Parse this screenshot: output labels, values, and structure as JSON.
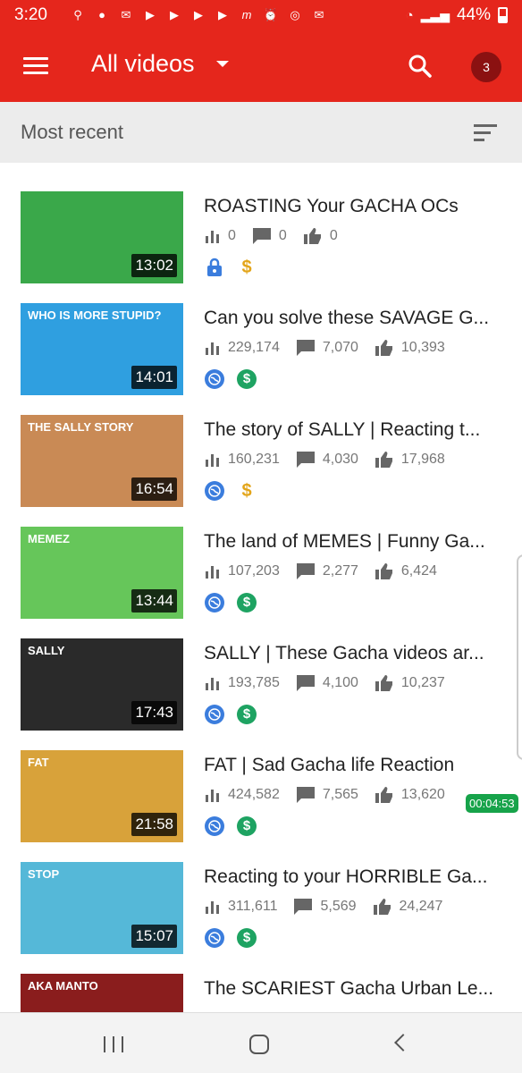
{
  "status_bar": {
    "time": "3:20",
    "battery": "44%",
    "notification_icons": [
      "location-icon",
      "reddit-icon",
      "gmail-icon",
      "youtube-icon",
      "youtube-icon",
      "youtube-icon",
      "youtube-icon",
      "m-icon",
      "alarm-icon",
      "instagram-icon",
      "gmail-icon"
    ]
  },
  "app_bar": {
    "title": "All videos",
    "notification_count": "3"
  },
  "sort_bar": {
    "label": "Most recent"
  },
  "videos": [
    {
      "title": "ROASTING Your GACHA OCs",
      "duration": "13:02",
      "views": "0",
      "comments": "0",
      "likes": "0",
      "visibility": "lock-icon",
      "monetization": "dollar-icon",
      "thumb_color": "#3aa84a"
    },
    {
      "title": "Can you solve these SAVAGE G...",
      "duration": "14:01",
      "views": "229,174",
      "comments": "7,070",
      "likes": "10,393",
      "visibility": "globe-icon",
      "monetization": "money-icon",
      "thumb_color": "#2f9fe0",
      "thumb_caption": "WHO IS MORE STUPID?"
    },
    {
      "title": "The story of SALLY | Reacting t...",
      "duration": "16:54",
      "views": "160,231",
      "comments": "4,030",
      "likes": "17,968",
      "visibility": "globe-icon",
      "monetization": "dollar-icon",
      "thumb_color": "#c98a55",
      "thumb_caption": "THE SALLY STORY"
    },
    {
      "title": "The land of MEMES | Funny Ga...",
      "duration": "13:44",
      "views": "107,203",
      "comments": "2,277",
      "likes": "6,424",
      "visibility": "globe-icon",
      "monetization": "money-icon",
      "thumb_color": "#66c65a",
      "thumb_caption": "MEMEZ"
    },
    {
      "title": "SALLY | These Gacha videos ar...",
      "duration": "17:43",
      "views": "193,785",
      "comments": "4,100",
      "likes": "10,237",
      "visibility": "globe-icon",
      "monetization": "money-icon",
      "thumb_color": "#2a2a2a",
      "thumb_caption": "SALLY"
    },
    {
      "title": "FAT | Sad Gacha life Reaction",
      "duration": "21:58",
      "views": "424,582",
      "comments": "7,565",
      "likes": "13,620",
      "visibility": "globe-icon",
      "monetization": "money-icon",
      "thumb_color": "#d8a23a",
      "thumb_caption": "FAT"
    },
    {
      "title": "Reacting to your HORRIBLE Ga...",
      "duration": "15:07",
      "views": "311,611",
      "comments": "5,569",
      "likes": "24,247",
      "visibility": "globe-icon",
      "monetization": "money-icon",
      "thumb_color": "#55b8d8",
      "thumb_caption": "STOP"
    },
    {
      "title": "The SCARIEST Gacha Urban Le...",
      "duration": "",
      "views": "",
      "comments": "",
      "likes": "",
      "visibility": "",
      "monetization": "",
      "thumb_color": "#8a1d1d",
      "thumb_caption": "AKA MANTO"
    }
  ],
  "overlay": {
    "timer": "00:04:53"
  },
  "colors": {
    "primary": "#e5261c",
    "badge": "#8b1111",
    "globe": "#3b7ddd",
    "money": "#1ea362",
    "dollar": "#e3a51a",
    "timer": "#17a34a"
  }
}
